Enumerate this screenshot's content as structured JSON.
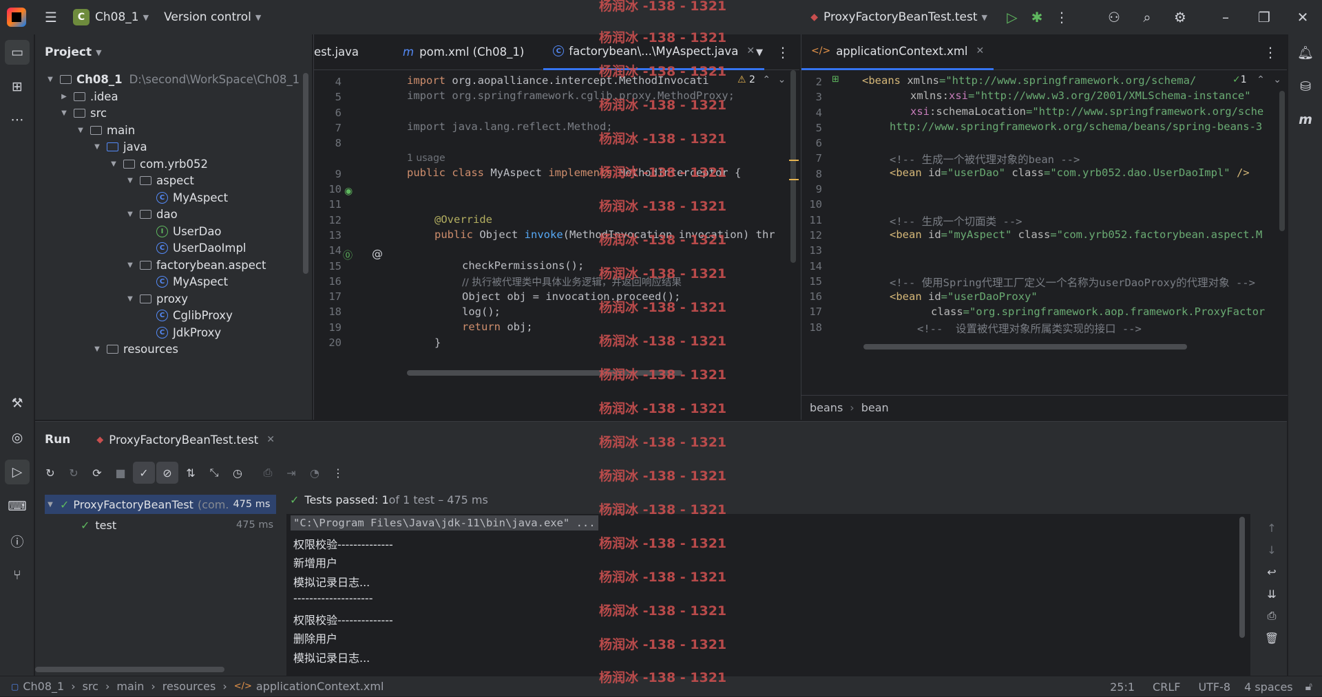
{
  "titlebar": {
    "project_letter": "C",
    "project_name": "Ch08_1",
    "vcs_label": "Version control",
    "run_config": "ProxyFactoryBeanTest.test"
  },
  "project_panel": {
    "title": "Project",
    "tree": [
      {
        "label": "Ch08_1",
        "path": "D:\\second\\WorkSpace\\Ch08_1",
        "kind": "module",
        "expand": "open"
      },
      {
        "label": ".idea",
        "kind": "folder",
        "expand": "closed"
      },
      {
        "label": "src",
        "kind": "folder",
        "expand": "open"
      },
      {
        "label": "main",
        "kind": "folder",
        "expand": "open"
      },
      {
        "label": "java",
        "kind": "folder-blue",
        "expand": "open"
      },
      {
        "label": "com.yrb052",
        "kind": "package",
        "expand": "open"
      },
      {
        "label": "aspect",
        "kind": "package",
        "expand": "open"
      },
      {
        "label": "MyAspect",
        "kind": "class"
      },
      {
        "label": "dao",
        "kind": "package",
        "expand": "open"
      },
      {
        "label": "UserDao",
        "kind": "interface"
      },
      {
        "label": "UserDaoImpl",
        "kind": "class"
      },
      {
        "label": "factorybean.aspect",
        "kind": "package",
        "expand": "open"
      },
      {
        "label": "MyAspect",
        "kind": "class"
      },
      {
        "label": "proxy",
        "kind": "package",
        "expand": "open"
      },
      {
        "label": "CglibProxy",
        "kind": "class"
      },
      {
        "label": "JdkProxy",
        "kind": "class"
      },
      {
        "label": "resources",
        "kind": "package",
        "expand": "open"
      }
    ]
  },
  "editor_left": {
    "tabs": [
      {
        "label": "est.java"
      },
      {
        "label": "pom.xml (Ch08_1)"
      },
      {
        "label": "factorybean\\...\\MyAspect.java"
      }
    ],
    "warnings": "2",
    "usage_hint": "1 usage",
    "line_numbers": [
      "4",
      "5",
      "6",
      "7",
      "8",
      "9",
      "10",
      "11",
      "12",
      "13",
      "14",
      "15",
      "16",
      "17",
      "18",
      "19",
      "20"
    ],
    "code": {
      "l4_kw": "import",
      "l4_rest": " org.aopalliance.intercept.MethodInvocati",
      "l5": "import org.springframework.cglib.proxy.MethodProxy;",
      "l7": "import java.lang.reflect.Method;",
      "l9_a": "public class",
      "l9_b": " MyAspect ",
      "l9_c": "implements",
      "l9_d": " MethodInterceptor {",
      "l12": "@Override",
      "l13_a": "public",
      "l13_b": " Object ",
      "l13_c": "invoke",
      "l13_d": "(MethodInvocation invocation) thr",
      "l15": "checkPermissions();",
      "l16": "// 执行被代理类中具体业务逻辑，并返回响应结果",
      "l17": "Object obj = invocation.proceed();",
      "l18": "log();",
      "l19_a": "return",
      "l19_b": " obj;",
      "l20": "}"
    }
  },
  "editor_right": {
    "tab": "applicationContext.xml",
    "checks": "1",
    "line_numbers": [
      "2",
      "3",
      "4",
      "5",
      "6",
      "7",
      "8",
      "9",
      "10",
      "11",
      "12",
      "13",
      "14",
      "15",
      "16",
      "17",
      "18"
    ],
    "code": {
      "l2_a": "<beans",
      "l2_b": " xmlns",
      "l2_c": "=\"http://www.springframework.org/schema/",
      "l3_a": "xmlns:",
      "l3_b": "xsi",
      "l3_c": "=\"http://www.w3.org/2001/XMLSchema-instance\"",
      "l4_a": "xsi",
      "l4_b": ":schemaLocation",
      "l4_c": "=\"http://www.springframework.org/sche",
      "l5": "http://www.springframework.org/schema/beans/spring-beans-3",
      "l7": "<!-- 生成一个被代理对象的bean -->",
      "l8_a": "<bean",
      "l8_b": " id",
      "l8_c": "=\"userDao\"",
      "l8_d": " class",
      "l8_e": "=\"com.yrb052.dao.UserDaoImpl\"",
      "l8_f": " />",
      "l11": "<!-- 生成一个切面类 -->",
      "l12_a": "<bean",
      "l12_b": " id",
      "l12_c": "=\"myAspect\"",
      "l12_d": " class",
      "l12_e": "=\"com.yrb052.factorybean.aspect.M",
      "l15": "<!-- 使用Spring代理工厂定义一个名称为userDaoProxy的代理对象 -->",
      "l16_a": "<bean",
      "l16_b": " id",
      "l16_c": "=\"userDaoProxy\"",
      "l17_a": "class",
      "l17_b": "=\"org.springframework.aop.framework.ProxyFactor",
      "l18": "<!--  设置被代理对象所属类实现的接口 -->"
    },
    "breadcrumb": [
      "beans",
      "bean"
    ]
  },
  "run_panel": {
    "title": "Run",
    "tab": "ProxyFactoryBeanTest",
    "test_root": {
      "name": "ProxyFactoryBeanTest",
      "pkg": "(com.",
      "time": "475 ms"
    },
    "test_child": {
      "name": "test",
      "time": "475 ms"
    },
    "summary_bold": "Tests passed: 1",
    "summary_rest": " of 1 test – 475 ms",
    "console": [
      "\"C:\\Program Files\\Java\\jdk-11\\bin\\java.exe\" ...",
      "权限校验--------------",
      "新增用户",
      "模拟记录日志...",
      "--------------------",
      "权限校验--------------",
      "删除用户",
      "模拟记录日志..."
    ]
  },
  "statusbar": {
    "crumbs": [
      "Ch08_1",
      "src",
      "main",
      "resources",
      "applicationContext.xml"
    ],
    "position": "25:1",
    "line_sep": "CRLF",
    "encoding": "UTF-8",
    "indent": "4 spaces"
  },
  "watermark": "杨润冰 -138 - 1321",
  "colors": {
    "accent": "#3574f0",
    "success": "#5fb85f",
    "watermark": "#c94f4f"
  }
}
